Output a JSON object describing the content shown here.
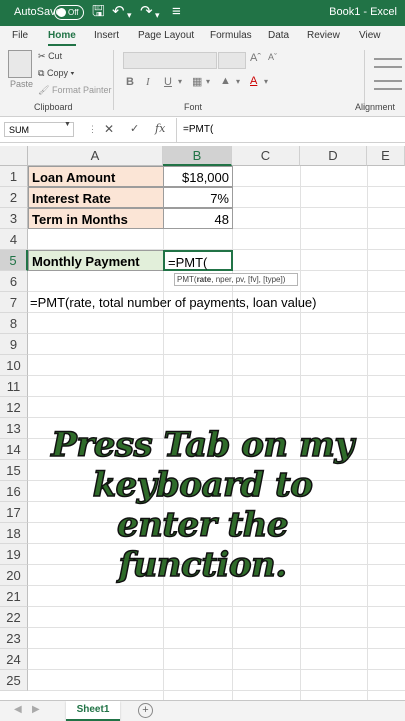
{
  "titlebar": {
    "autosave": "AutoSave",
    "toggle": "Off",
    "title": "Book1 - Excel"
  },
  "menu": [
    "File",
    "Home",
    "Insert",
    "Page Layout",
    "Formulas",
    "Data",
    "Review",
    "View"
  ],
  "ribbon": {
    "paste": "Paste",
    "cut": "Cut",
    "copy": "Copy",
    "format_painter": "Format Painter",
    "clipboard_group": "Clipboard",
    "font_group": "Font",
    "alignment_group": "Alignment"
  },
  "formula_bar": {
    "name_box": "SUM",
    "fx": "fx",
    "content": "=PMT("
  },
  "columns": [
    "A",
    "B",
    "C",
    "D",
    "E"
  ],
  "rows": [
    "1",
    "2",
    "3",
    "4",
    "5",
    "6",
    "7",
    "8",
    "9",
    "10",
    "11",
    "12",
    "13",
    "14",
    "15",
    "16",
    "17",
    "18",
    "19",
    "20",
    "21",
    "22",
    "23",
    "24",
    "25"
  ],
  "cells": {
    "a1": "Loan Amount",
    "b1": "$18,000",
    "a2": "Interest Rate",
    "b2": "7%",
    "a3": "Term in Months",
    "b3": "48",
    "a5": "Monthly Payment",
    "b5": "=PMT(",
    "a7": "=PMT(rate, total number of payments, loan value)"
  },
  "tooltip": {
    "func": "PMT(",
    "arg1": "rate",
    "rest": ", nper, pv, [fv], [type])"
  },
  "overlay": [
    "Press Tab on my",
    "keyboard to",
    "enter the",
    "function."
  ],
  "sheet_tab": "Sheet1",
  "colors": {
    "excel_green": "#217346",
    "label_fill": "#fbe5d6",
    "green_fill": "#e2efda",
    "overlay_text": "#2f6b2a"
  }
}
